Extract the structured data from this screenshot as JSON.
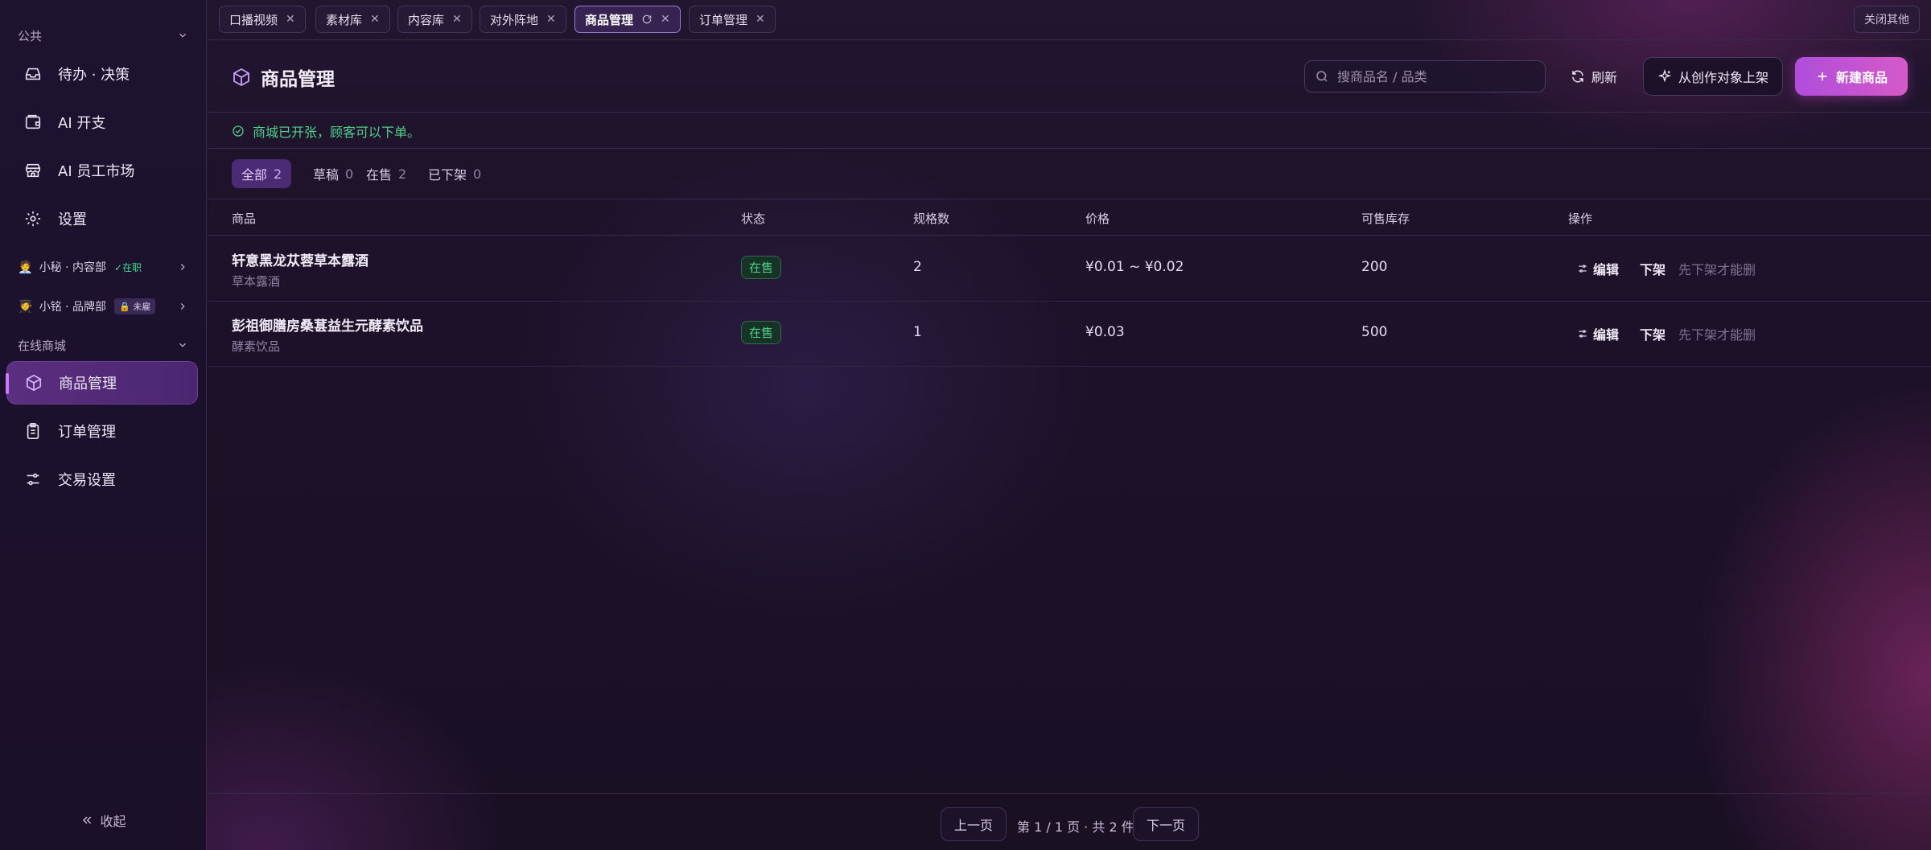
{
  "sidebar": {
    "sections": {
      "public": "公共",
      "mall": "在线商城"
    },
    "items": {
      "todo": "待办 · 决策",
      "ai_expense": "AI 开支",
      "ai_market": "AI 员工市场",
      "settings": "设置",
      "products": "商品管理",
      "orders": "订单管理",
      "trade_settings": "交易设置"
    },
    "agents": [
      {
        "emoji": "🧑‍💼",
        "name": "小秘 · 内容部",
        "status": "✓在职"
      },
      {
        "emoji": "🧑‍🎓",
        "name": "小铭 · 品牌部",
        "status": "🔒 未雇"
      }
    ],
    "collapse": "收起"
  },
  "tabs": [
    {
      "label": "口播视频"
    },
    {
      "label": "素材库"
    },
    {
      "label": "内容库"
    },
    {
      "label": "对外阵地"
    },
    {
      "label": "商品管理"
    },
    {
      "label": "订单管理"
    }
  ],
  "tabbar": {
    "close_others": "关闭其他"
  },
  "header": {
    "title": "商品管理",
    "search_placeholder": "搜商品名 / 品类",
    "refresh": "刷新",
    "create_from": "从创作对象上架",
    "new_product": "新建商品"
  },
  "notice": "商城已开张，顾客可以下单。",
  "filters": [
    {
      "label": "全部",
      "count": "2"
    },
    {
      "label": "草稿",
      "count": "0"
    },
    {
      "label": "在售",
      "count": "2"
    },
    {
      "label": "已下架",
      "count": "0"
    }
  ],
  "table": {
    "columns": [
      "商品",
      "状态",
      "规格数",
      "价格",
      "可售库存",
      "操作"
    ],
    "rows": [
      {
        "name": "轩意黑龙苁蓉草本露酒",
        "category": "草本露酒",
        "status": "在售",
        "specs": "2",
        "price": "¥0.01 ~ ¥0.02",
        "stock": "200",
        "edit": "编辑",
        "off": "下架",
        "hint": "先下架才能删"
      },
      {
        "name": "彭祖御膳房桑葚益生元酵素饮品",
        "category": "酵素饮品",
        "status": "在售",
        "specs": "1",
        "price": "¥0.03",
        "stock": "500",
        "edit": "编辑",
        "off": "下架",
        "hint": "先下架才能删"
      }
    ]
  },
  "pagination": {
    "prev": "上一页",
    "info": "第 1 / 1 页 · 共 2 件",
    "next": "下一页"
  },
  "colors": {
    "accent": "#c77dff",
    "success": "#4fd08a",
    "primary_btn": "#c452d4"
  }
}
